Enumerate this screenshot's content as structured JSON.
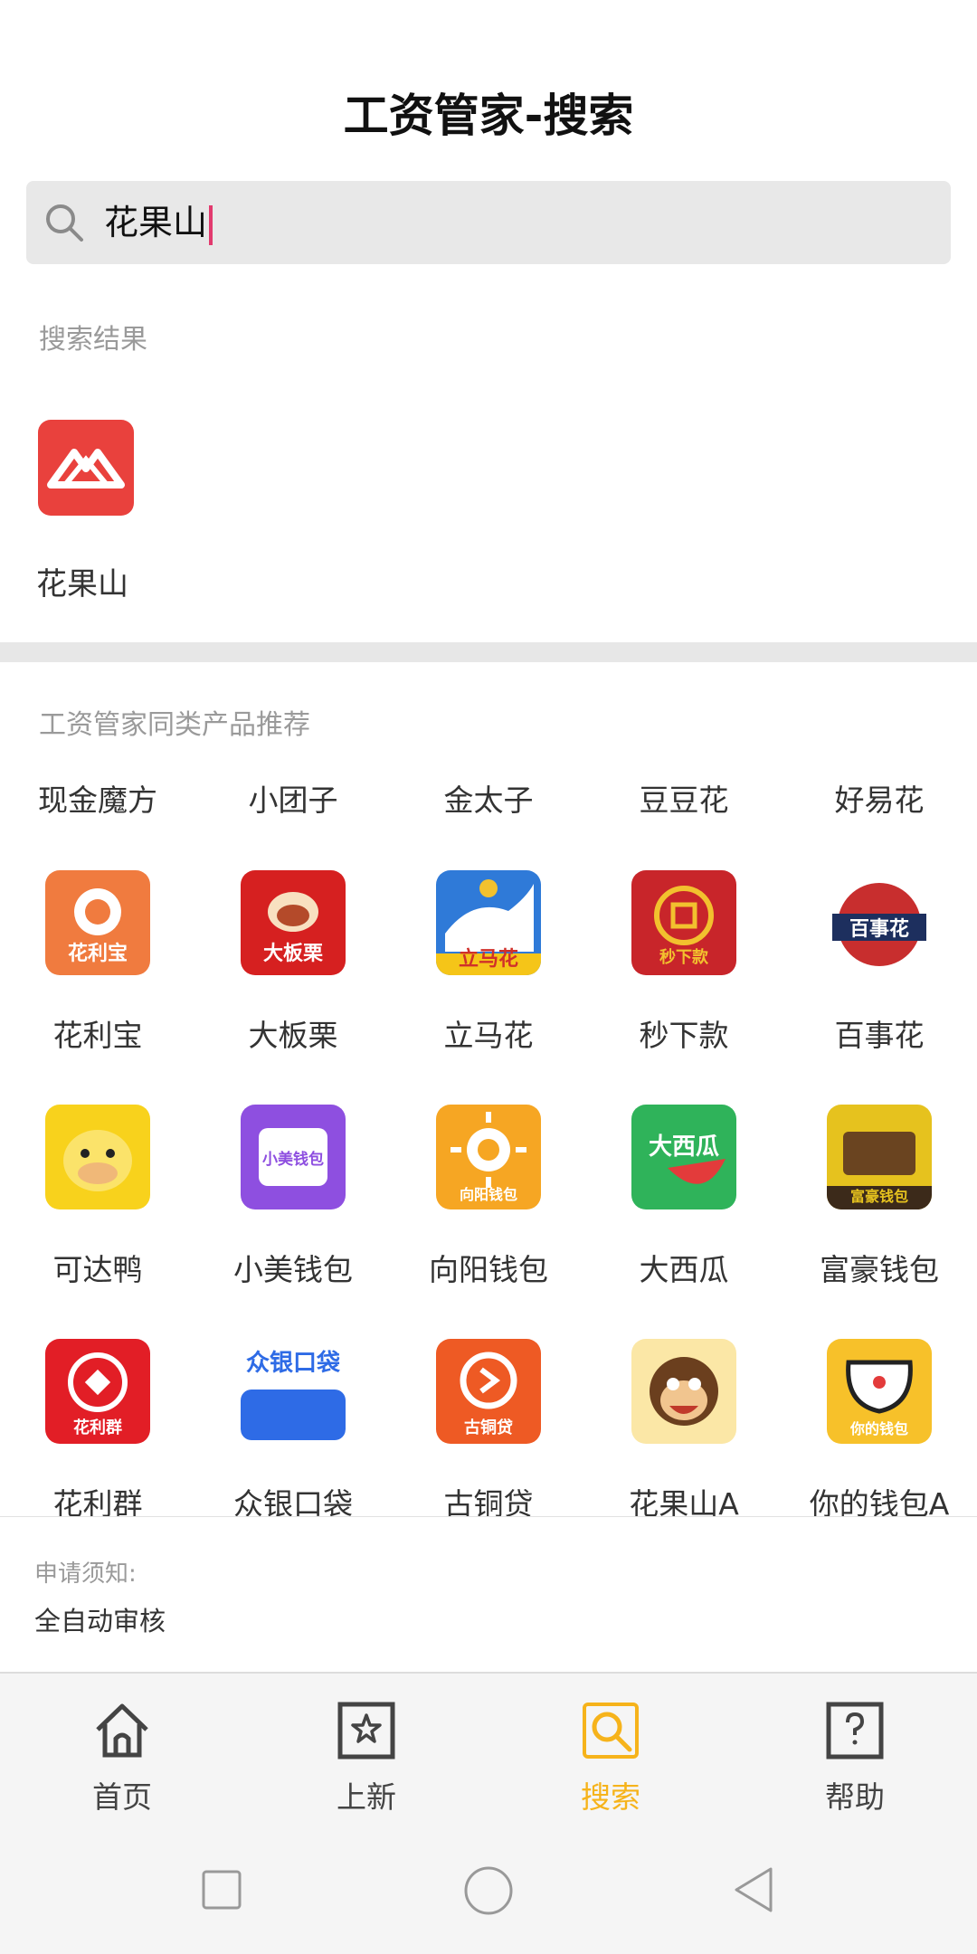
{
  "header": {
    "title": "工资管家-搜索"
  },
  "search": {
    "value": "花果山"
  },
  "results": {
    "label": "搜索结果",
    "items": [
      {
        "name": "花果山"
      }
    ]
  },
  "recommend": {
    "label": "工资管家同类产品推荐",
    "tabs": [
      "现金魔方",
      "小团子",
      "金太子",
      "豆豆花",
      "好易花"
    ],
    "rows": [
      [
        {
          "name": "花利宝",
          "icon_text": "花利宝"
        },
        {
          "name": "大板栗",
          "icon_text": "大板栗"
        },
        {
          "name": "立马花",
          "icon_text": "立马花"
        },
        {
          "name": "秒下款",
          "icon_text": "秒下款"
        },
        {
          "name": "百事花",
          "icon_text": "百事花"
        }
      ],
      [
        {
          "name": "可达鸭",
          "icon_text": ""
        },
        {
          "name": "小美钱包",
          "icon_text": "小美钱包"
        },
        {
          "name": "向阳钱包",
          "icon_text": "向阳钱包"
        },
        {
          "name": "大西瓜",
          "icon_text": "大西瓜"
        },
        {
          "name": "富豪钱包",
          "icon_text": "富豪钱包"
        }
      ],
      [
        {
          "name": "花利群",
          "icon_text": "花利群"
        },
        {
          "name": "众银口袋",
          "icon_text": "众银口袋"
        },
        {
          "name": "古铜贷",
          "icon_text": "古铜贷"
        },
        {
          "name": "花果山A",
          "icon_text": ""
        },
        {
          "name": "你的钱包A",
          "icon_text": "你的钱包"
        }
      ]
    ]
  },
  "notice": {
    "label": "申请须知:",
    "text": "全自动审核"
  },
  "nav": {
    "items": [
      {
        "label": "首页"
      },
      {
        "label": "上新"
      },
      {
        "label": "搜索"
      },
      {
        "label": "帮助"
      }
    ],
    "active_color": "#f6b31b"
  }
}
